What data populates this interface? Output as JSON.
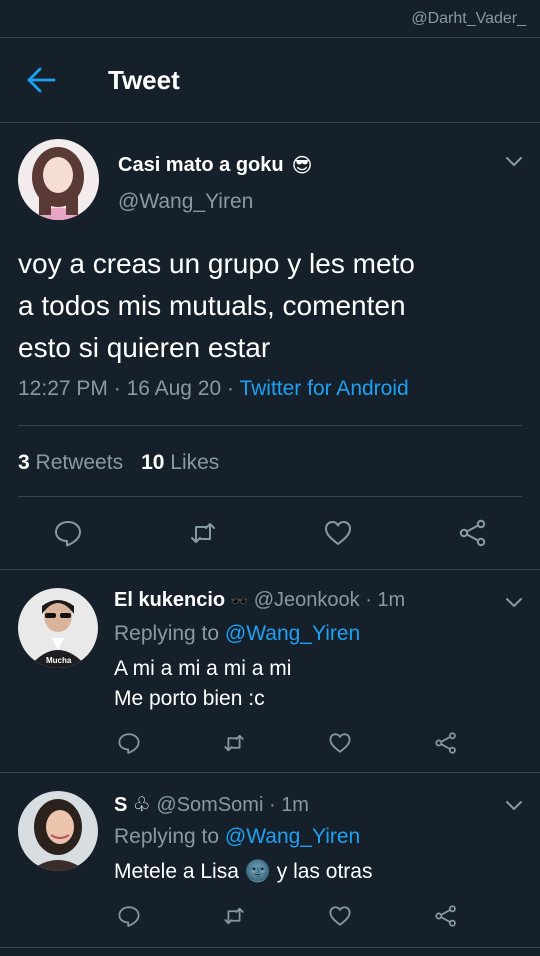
{
  "watermark": "@Darht_Vader_",
  "header": {
    "title": "Tweet"
  },
  "main_tweet": {
    "display_name": "Casi mato a goku",
    "name_emoji": "😎",
    "handle": "@Wang_Yiren",
    "text_lines": [
      "voy a creas un grupo y les meto",
      "a todos mis mutuals, comenten",
      "esto si quieren estar"
    ],
    "time": "12:27 PM",
    "date": "16 Aug 20",
    "source": "Twitter for Android",
    "retweets_count": "3",
    "retweets_label": "Retweets",
    "likes_count": "10",
    "likes_label": "Likes"
  },
  "replies": [
    {
      "name": "El kukencio",
      "name_emoji": "🕶️",
      "handle": "@Jeonkook",
      "time": "1m",
      "replying_label": "Replying to",
      "replying_handle": "@Wang_Yiren",
      "lines": [
        "A mi a mi a mi a mi",
        "Me porto bien :c"
      ],
      "avatar_caption": "Mucha"
    },
    {
      "name": "S",
      "name_symbol": "♧",
      "handle": "@SomSomi",
      "time": "1m",
      "replying_label": "Replying to",
      "replying_handle": "@Wang_Yiren",
      "line_before": "Metele a Lisa",
      "line_emoji": "🌚",
      "line_after": "y las otras"
    }
  ],
  "colors": {
    "background": "#15202b",
    "accent": "#1da1f2",
    "secondary_text": "#8899a6",
    "divider": "#38444d"
  }
}
